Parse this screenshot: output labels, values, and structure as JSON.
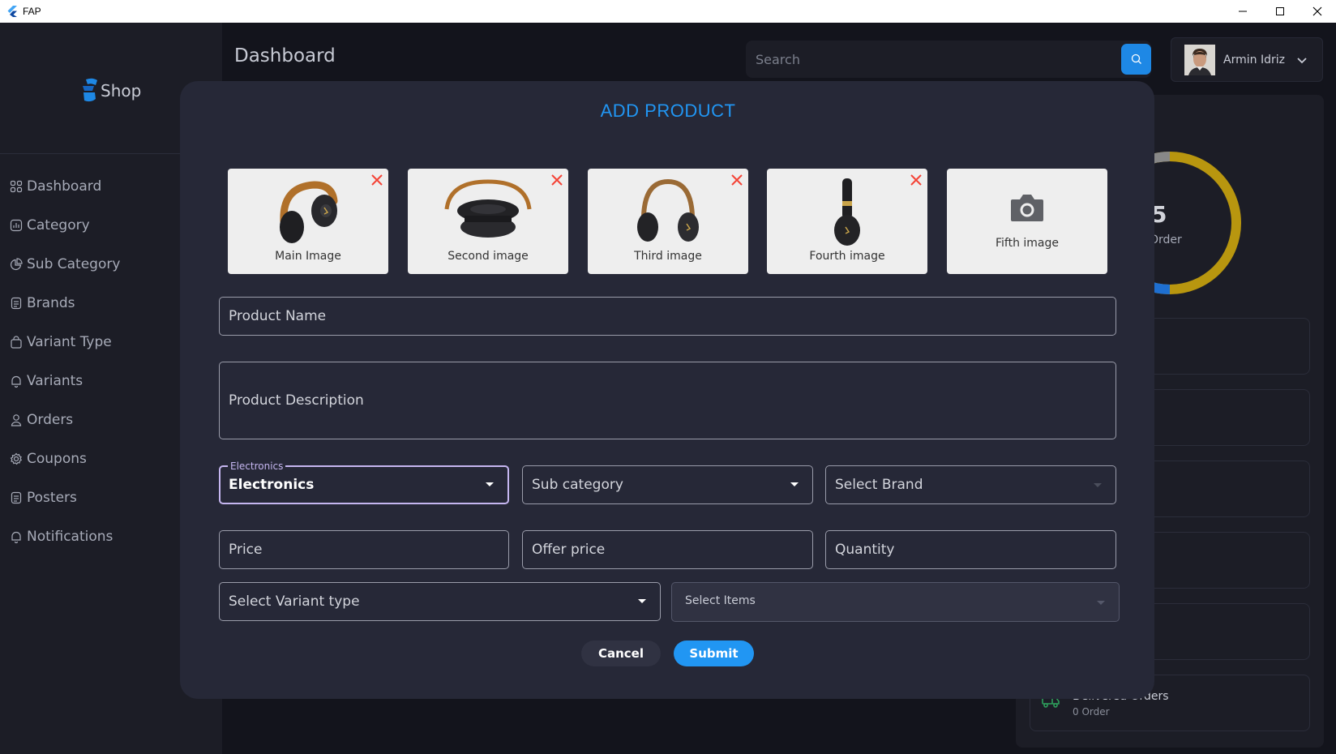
{
  "window": {
    "title": "FAP"
  },
  "sidebar": {
    "logo_text": "Shop",
    "items": [
      {
        "label": "Dashboard",
        "icon": "grid-icon"
      },
      {
        "label": "Category",
        "icon": "chart-icon"
      },
      {
        "label": "Sub Category",
        "icon": "pie-icon"
      },
      {
        "label": "Brands",
        "icon": "document-icon"
      },
      {
        "label": "Variant Type",
        "icon": "bag-icon"
      },
      {
        "label": "Variants",
        "icon": "bell-icon"
      },
      {
        "label": "Orders",
        "icon": "user-icon"
      },
      {
        "label": "Coupons",
        "icon": "gear-icon"
      },
      {
        "label": "Posters",
        "icon": "document-icon"
      },
      {
        "label": "Notifications",
        "icon": "bell-icon"
      }
    ]
  },
  "header": {
    "title": "Dashboard",
    "search_placeholder": "Search",
    "user_name": "Armin Idriz"
  },
  "summary": {
    "total_orders": "5",
    "total_label": "Order",
    "delivered_title": "Delivered Orders",
    "delivered_count": "0 Order"
  },
  "dialog": {
    "title": "ADD PRODUCT",
    "images": [
      {
        "label": "Main Image",
        "has_image": true
      },
      {
        "label": "Second image",
        "has_image": true
      },
      {
        "label": "Third image",
        "has_image": true
      },
      {
        "label": "Fourth image",
        "has_image": true
      },
      {
        "label": "Fifth image",
        "has_image": false
      }
    ],
    "product_name_label": "Product Name",
    "product_description_label": "Product Description",
    "category": {
      "floating_label": "Electronics",
      "value": "Electronics"
    },
    "subcategory_label": "Sub category",
    "brand_label": "Select Brand",
    "price_label": "Price",
    "offer_price_label": "Offer price",
    "quantity_label": "Quantity",
    "variant_type_label": "Select Variant type",
    "variant_items_label": "Select Items",
    "cancel_label": "Cancel",
    "submit_label": "Submit"
  },
  "colors": {
    "accent": "#2196f3",
    "focus": "#c5b6f0",
    "error": "#f44336",
    "background": "#13141c",
    "surface": "#1c1d26",
    "dialog": "#262837"
  }
}
